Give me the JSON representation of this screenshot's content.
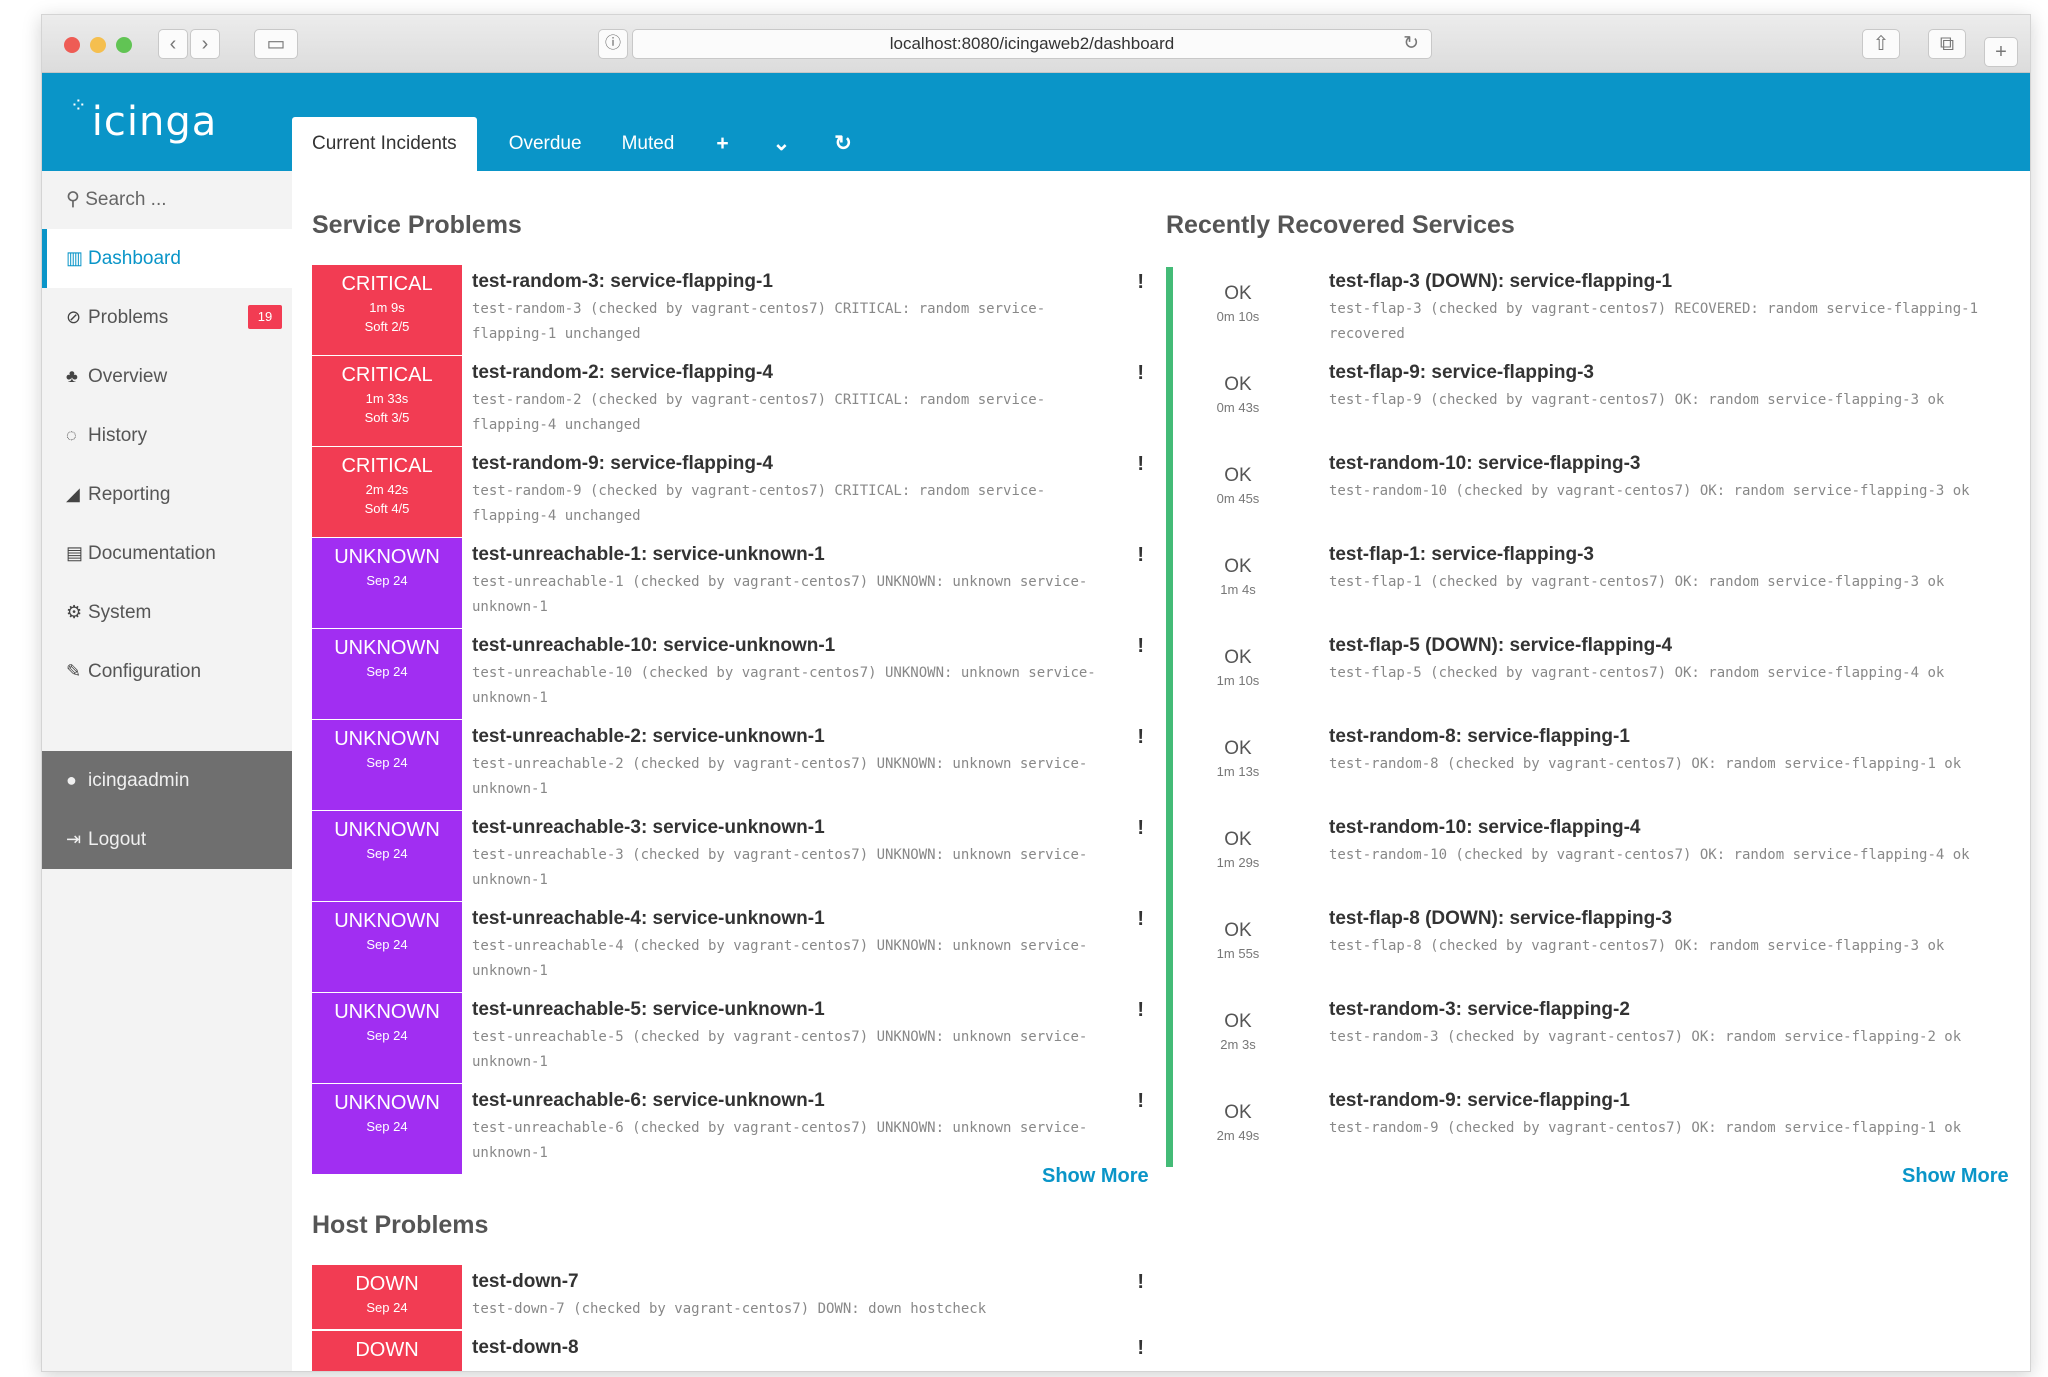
{
  "browser": {
    "url": "localhost:8080/icingaweb2/dashboard",
    "colors": {
      "close": "#ee5c55",
      "minimize": "#f5bf4f",
      "maximize": "#61c454"
    }
  },
  "app": {
    "logo": "icinga",
    "tabs": [
      {
        "label": "Current Incidents"
      },
      {
        "label": "Overdue"
      },
      {
        "label": "Muted"
      },
      {
        "label": "+"
      },
      {
        "label": "⌄"
      },
      {
        "label": "↻"
      }
    ],
    "accent": "#0a95c8"
  },
  "sidebar": {
    "search_placeholder": "Search ...",
    "items": [
      {
        "label": "Dashboard",
        "icon": "dashboard-icon"
      },
      {
        "label": "Problems",
        "icon": "problems-icon",
        "badge": "19"
      },
      {
        "label": "Overview",
        "icon": "overview-icon"
      },
      {
        "label": "History",
        "icon": "history-icon"
      },
      {
        "label": "Reporting",
        "icon": "reporting-icon"
      },
      {
        "label": "Documentation",
        "icon": "documentation-icon"
      },
      {
        "label": "System",
        "icon": "system-icon"
      },
      {
        "label": "Configuration",
        "icon": "configuration-icon"
      }
    ],
    "user": {
      "name": "icingaadmin",
      "logout": "Logout"
    }
  },
  "service_problems": {
    "title": "Service Problems",
    "show_more": "Show More",
    "rows": [
      {
        "state": "CRITICAL",
        "line1": "1m 9s",
        "line2": "Soft 2/5",
        "title": "test-random-3: service-flapping-1",
        "output": "test-random-3 (checked by vagrant-centos7) CRITICAL: random service-flapping-1 unchanged"
      },
      {
        "state": "CRITICAL",
        "line1": "1m 33s",
        "line2": "Soft 3/5",
        "title": "test-random-2: service-flapping-4",
        "output": "test-random-2 (checked by vagrant-centos7) CRITICAL: random service-flapping-4 unchanged"
      },
      {
        "state": "CRITICAL",
        "line1": "2m 42s",
        "line2": "Soft 4/5",
        "title": "test-random-9: service-flapping-4",
        "output": "test-random-9 (checked by vagrant-centos7) CRITICAL: random service-flapping-4 unchanged"
      },
      {
        "state": "UNKNOWN",
        "line1": "Sep 24",
        "line2": "",
        "title": "test-unreachable-1: service-unknown-1",
        "output": "test-unreachable-1 (checked by vagrant-centos7) UNKNOWN: unknown service-unknown-1"
      },
      {
        "state": "UNKNOWN",
        "line1": "Sep 24",
        "line2": "",
        "title": "test-unreachable-10: service-unknown-1",
        "output": "test-unreachable-10 (checked by vagrant-centos7) UNKNOWN: unknown service-unknown-1"
      },
      {
        "state": "UNKNOWN",
        "line1": "Sep 24",
        "line2": "",
        "title": "test-unreachable-2: service-unknown-1",
        "output": "test-unreachable-2 (checked by vagrant-centos7) UNKNOWN: unknown service-unknown-1"
      },
      {
        "state": "UNKNOWN",
        "line1": "Sep 24",
        "line2": "",
        "title": "test-unreachable-3: service-unknown-1",
        "output": "test-unreachable-3 (checked by vagrant-centos7) UNKNOWN: unknown service-unknown-1"
      },
      {
        "state": "UNKNOWN",
        "line1": "Sep 24",
        "line2": "",
        "title": "test-unreachable-4: service-unknown-1",
        "output": "test-unreachable-4 (checked by vagrant-centos7) UNKNOWN: unknown service-unknown-1"
      },
      {
        "state": "UNKNOWN",
        "line1": "Sep 24",
        "line2": "",
        "title": "test-unreachable-5: service-unknown-1",
        "output": "test-unreachable-5 (checked by vagrant-centos7) UNKNOWN: unknown service-unknown-1"
      },
      {
        "state": "UNKNOWN",
        "line1": "Sep 24",
        "line2": "",
        "title": "test-unreachable-6: service-unknown-1",
        "output": "test-unreachable-6 (checked by vagrant-centos7) UNKNOWN: unknown service-unknown-1"
      }
    ]
  },
  "recovered_services": {
    "title": "Recently Recovered Services",
    "show_more": "Show More",
    "rows": [
      {
        "state": "OK",
        "since": "0m 10s",
        "title": "test-flap-3 (DOWN): service-flapping-1",
        "output": "test-flap-3 (checked by vagrant-centos7) RECOVERED: random service-flapping-1 recovered"
      },
      {
        "state": "OK",
        "since": "0m 43s",
        "title": "test-flap-9: service-flapping-3",
        "output": "test-flap-9 (checked by vagrant-centos7) OK: random service-flapping-3 ok"
      },
      {
        "state": "OK",
        "since": "0m 45s",
        "title": "test-random-10: service-flapping-3",
        "output": "test-random-10 (checked by vagrant-centos7) OK: random service-flapping-3 ok"
      },
      {
        "state": "OK",
        "since": "1m 4s",
        "title": "test-flap-1: service-flapping-3",
        "output": "test-flap-1 (checked by vagrant-centos7) OK: random service-flapping-3 ok"
      },
      {
        "state": "OK",
        "since": "1m 10s",
        "title": "test-flap-5 (DOWN): service-flapping-4",
        "output": "test-flap-5 (checked by vagrant-centos7) OK: random service-flapping-4 ok"
      },
      {
        "state": "OK",
        "since": "1m 13s",
        "title": "test-random-8: service-flapping-1",
        "output": "test-random-8 (checked by vagrant-centos7) OK: random service-flapping-1 ok"
      },
      {
        "state": "OK",
        "since": "1m 29s",
        "title": "test-random-10: service-flapping-4",
        "output": "test-random-10 (checked by vagrant-centos7) OK: random service-flapping-4 ok"
      },
      {
        "state": "OK",
        "since": "1m 55s",
        "title": "test-flap-8 (DOWN): service-flapping-3",
        "output": "test-flap-8 (checked by vagrant-centos7) OK: random service-flapping-3 ok"
      },
      {
        "state": "OK",
        "since": "2m 3s",
        "title": "test-random-3: service-flapping-2",
        "output": "test-random-3 (checked by vagrant-centos7) OK: random service-flapping-2 ok"
      },
      {
        "state": "OK",
        "since": "2m 49s",
        "title": "test-random-9: service-flapping-1",
        "output": "test-random-9 (checked by vagrant-centos7) OK: random service-flapping-1 ok"
      }
    ]
  },
  "host_problems": {
    "title": "Host Problems",
    "rows": [
      {
        "state": "DOWN",
        "line1": "Sep 24",
        "title": "test-down-7",
        "output": "test-down-7 (checked by vagrant-centos7) DOWN: down hostcheck"
      },
      {
        "state": "DOWN",
        "line1": "",
        "title": "test-down-8",
        "output": ""
      }
    ]
  }
}
